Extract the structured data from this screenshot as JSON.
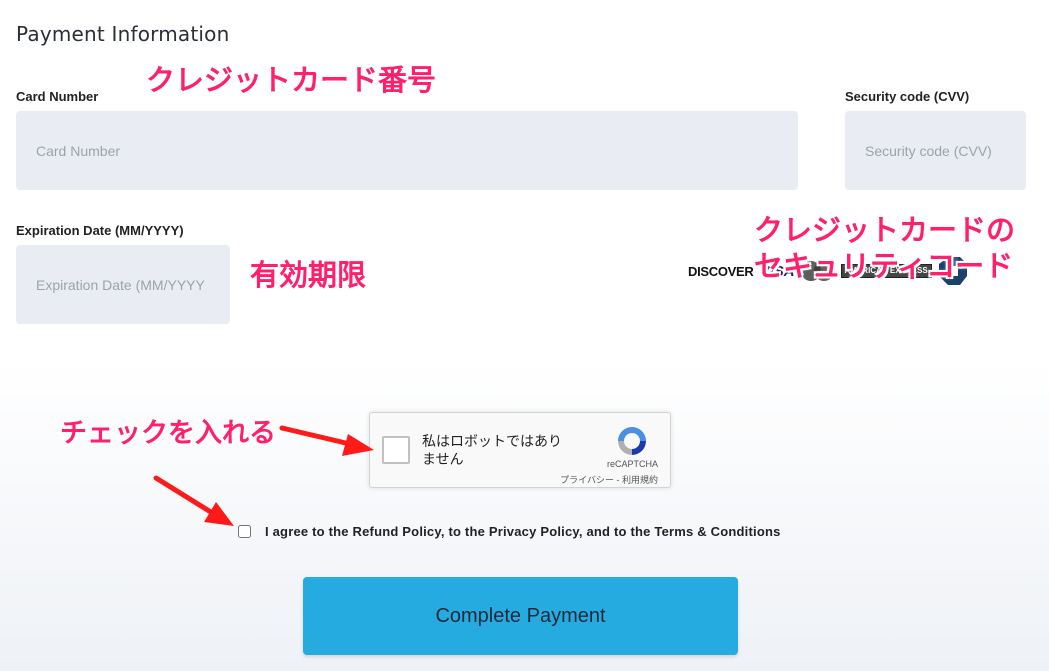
{
  "section_title": "Payment Information",
  "card_number": {
    "label": "Card Number",
    "placeholder": "Card Number",
    "value": ""
  },
  "security_code": {
    "label": "Security code (CVV)",
    "placeholder": "Security code (CVV)",
    "value": ""
  },
  "expiration": {
    "label": "Expiration Date (MM/YYYY)",
    "placeholder": "Expiration Date (MM/YYYY",
    "value": ""
  },
  "card_logos": [
    "DISCOVER",
    "VISA",
    "mastercard-icon",
    "AMERICAN EXPRESS",
    "chase-icon"
  ],
  "recaptcha": {
    "label": "私はロボットではありません",
    "brand": "reCAPTCHA",
    "privacy_link": "プライバシー",
    "separator": "-",
    "terms_link": "利用規約"
  },
  "agreement": {
    "text": "I agree to the Refund Policy, to the Privacy Policy, and to the Terms & Conditions",
    "checked": false
  },
  "submit_label": "Complete Payment",
  "annotations": {
    "card_number": "クレジットカード番号",
    "expiration": "有効期限",
    "security_line1": "クレジットカードの",
    "security_line2": "セキュリティコード",
    "check": "チェックを入れる"
  },
  "colors": {
    "accent_button": "#26abe1",
    "annotation": "#ff1f6a",
    "input_bg": "#e9edf3",
    "arrow": "#ff1a1a"
  }
}
